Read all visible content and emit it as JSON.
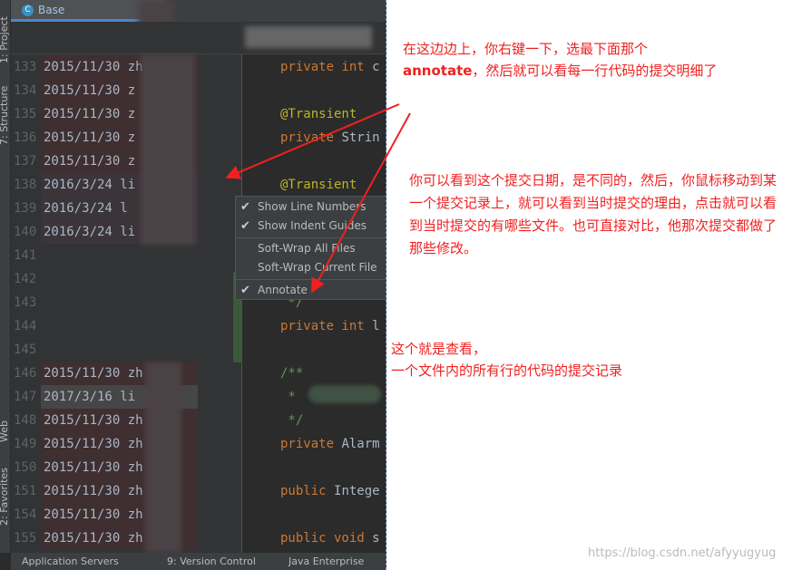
{
  "editor": {
    "tab_label": "Base",
    "tool_windows_left": [
      "1: Project",
      "7: Structure",
      "Web",
      "2: Favorites"
    ],
    "rows": [
      {
        "line": "133",
        "annotation": "2015/11/30 zh",
        "age": "old",
        "code": [
          [
            "kw",
            "private int "
          ],
          [
            "",
            "c"
          ]
        ]
      },
      {
        "line": "134",
        "annotation": "2015/11/30 z",
        "age": "old",
        "code": []
      },
      {
        "line": "135",
        "annotation": "2015/11/30 z",
        "age": "old",
        "code": [
          [
            "an",
            "@Transient"
          ]
        ]
      },
      {
        "line": "136",
        "annotation": "2015/11/30 z",
        "age": "old",
        "code": [
          [
            "kw",
            "private "
          ],
          [
            "",
            "Strin"
          ]
        ]
      },
      {
        "line": "137",
        "annotation": "2015/11/30 z",
        "age": "old",
        "code": []
      },
      {
        "line": "138",
        "annotation": "2016/3/24  li",
        "age": "mid",
        "code": [
          [
            "an",
            "@Transient"
          ]
        ]
      },
      {
        "line": "139",
        "annotation": "2016/3/24  l",
        "age": "mid",
        "code": []
      },
      {
        "line": "140",
        "annotation": "2016/3/24  li",
        "age": "mid",
        "code": []
      },
      {
        "line": "141",
        "annotation": "",
        "age": "",
        "code": []
      },
      {
        "line": "142",
        "annotation": "",
        "age": "",
        "code": []
      },
      {
        "line": "143",
        "annotation": "",
        "age": "",
        "code": [
          [
            "cm",
            " */"
          ]
        ]
      },
      {
        "line": "144",
        "annotation": "",
        "age": "",
        "code": [
          [
            "kw",
            "private int "
          ],
          [
            "",
            "l"
          ]
        ]
      },
      {
        "line": "145",
        "annotation": "",
        "age": "",
        "code": []
      },
      {
        "line": "146",
        "annotation": "2015/11/30 zh",
        "age": "old",
        "code": [
          [
            "cm",
            "/**"
          ]
        ]
      },
      {
        "line": "147",
        "annotation": "2017/3/16  li",
        "age": "new",
        "code": [
          [
            "cm",
            " * "
          ]
        ]
      },
      {
        "line": "148",
        "annotation": "2015/11/30 zh",
        "age": "old",
        "code": [
          [
            "cm",
            " */"
          ]
        ]
      },
      {
        "line": "149",
        "annotation": "2015/11/30 zh",
        "age": "old",
        "code": [
          [
            "kw",
            "private "
          ],
          [
            "",
            "Alarm"
          ]
        ]
      },
      {
        "line": "150",
        "annotation": "2015/11/30 zh",
        "age": "old",
        "code": []
      },
      {
        "line": "151",
        "annotation": "2015/11/30 zh",
        "age": "old",
        "code": [
          [
            "kw",
            "public "
          ],
          [
            "",
            "Intege"
          ]
        ]
      },
      {
        "line": "154",
        "annotation": "2015/11/30 zh",
        "age": "old",
        "code": []
      },
      {
        "line": "155",
        "annotation": "2015/11/30 zh",
        "age": "old",
        "code": [
          [
            "kw",
            "public void "
          ],
          [
            "",
            "s"
          ]
        ]
      }
    ]
  },
  "context_menu": {
    "items": [
      {
        "label": "Show Line Numbers",
        "checked": true
      },
      {
        "label": "Show Indent Guides",
        "checked": true
      },
      {
        "label": "Soft-Wrap All Files",
        "checked": false
      },
      {
        "label": "Soft-Wrap Current File",
        "checked": false
      },
      {
        "label": "Annotate",
        "checked": true
      }
    ]
  },
  "statusbar": {
    "items": [
      "Application Servers",
      "9: Version Control",
      "Java Enterprise"
    ]
  },
  "notes": {
    "note1_a": "在这边边上，你右键一下，选最下面那个",
    "note1_bold": "annotate",
    "note1_b": "，然后就可以看每一行代码的提交明细了",
    "note2": "你可以看到这个提交日期，是不同的，然后，你鼠标移动到某一个提交记录上，就可以看到当时提交的理由，点击就可以看到当时提交的有哪些文件。也可直接对比，他那次提交都做了那些修改。",
    "note3_a": "这个就是查看，",
    "note3_b": "一个文件内的所有行的代码的提交记录"
  },
  "watermark": "https://blog.csdn.net/afyyugyug",
  "colors": {
    "annotation_red": "#f02020",
    "keyword": "#cc7832",
    "annotation": "#bbb529",
    "comment": "#629755"
  }
}
